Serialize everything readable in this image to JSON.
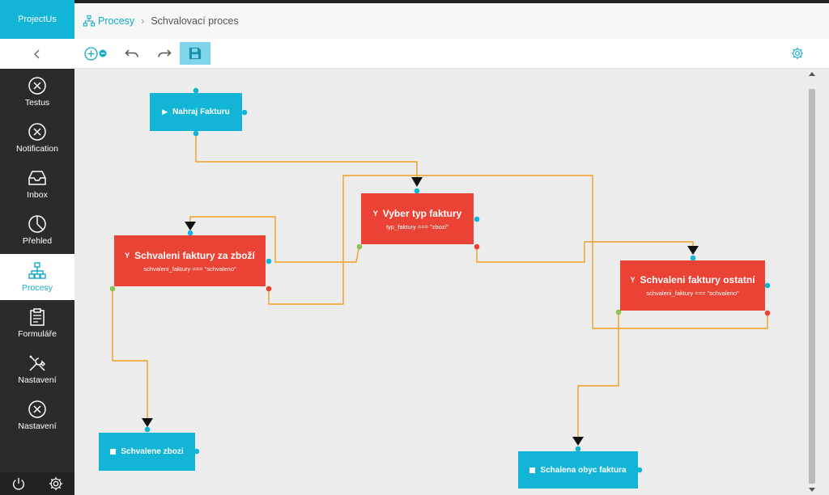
{
  "app": {
    "brand": "ProjectUs"
  },
  "breadcrumb": {
    "root": "Procesy",
    "current": "Schvalovací proces"
  },
  "sidebar": {
    "items": [
      {
        "label": "Testus",
        "icon": "circle-x-icon",
        "active": false
      },
      {
        "label": "Notification",
        "icon": "circle-x-icon",
        "active": false
      },
      {
        "label": "Inbox",
        "icon": "inbox-icon",
        "active": false
      },
      {
        "label": "Přehled",
        "icon": "pie-chart-icon",
        "active": false
      },
      {
        "label": "Procesy",
        "icon": "process-tree-icon",
        "active": true
      },
      {
        "label": "Formuláře",
        "icon": "clipboard-icon",
        "active": false
      },
      {
        "label": "Nastavení",
        "icon": "tools-icon",
        "active": false
      },
      {
        "label": "Nastavení",
        "icon": "circle-x-icon",
        "active": false
      }
    ],
    "footer": [
      "power-icon",
      "gear-icon"
    ]
  },
  "toolbar": {
    "tools": [
      "zoom-in-icon",
      "zoom-out-icon",
      "undo-icon",
      "redo-icon",
      "save-icon",
      "settings-icon"
    ]
  },
  "nodes": {
    "start": {
      "title": "Nahraj Fakturu",
      "icon": "play-icon"
    },
    "choice": {
      "title": "Vyber typ faktury",
      "condition": "typ_faktury === \"zbozi\"",
      "icon": "fork-icon"
    },
    "approve_goods": {
      "title": "Schvaleni faktury za zboží",
      "condition": "schvaleni_faktury === \"schvaleno\"",
      "icon": "fork-icon"
    },
    "approve_other": {
      "title": "Schvaleni faktury ostatní",
      "condition": "schvaleni_faktury === \"schvaleno\"",
      "icon": "fork-icon"
    },
    "end_goods": {
      "title": "Schvalene zbozi",
      "icon": "stop-icon"
    },
    "end_other": {
      "title": "Schalena obyc faktura",
      "icon": "stop-icon"
    }
  },
  "colors": {
    "accent": "#13b5d6",
    "decision": "#ea4335",
    "edge": "#f0a020",
    "port_in": "#13b5d6",
    "port_yes": "#8bc34a",
    "port_no": "#ea4335"
  }
}
